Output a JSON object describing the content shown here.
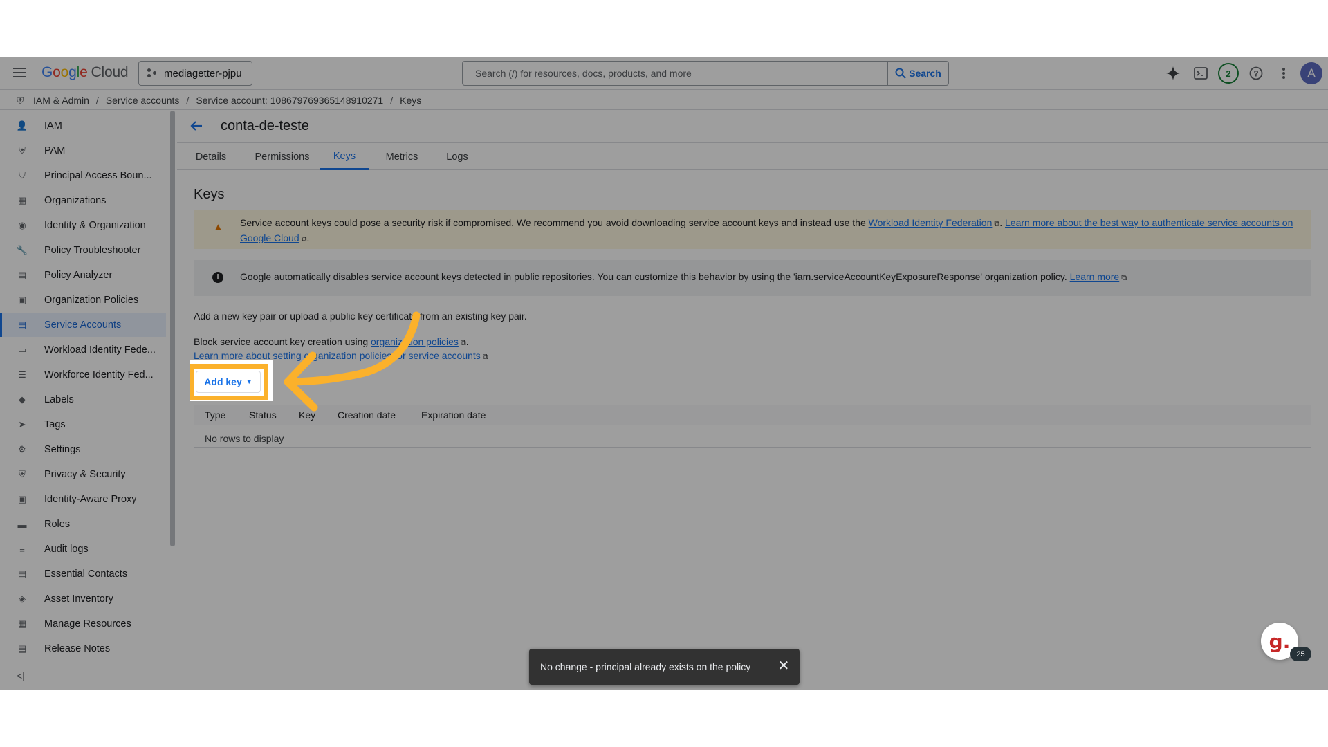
{
  "topbar": {
    "logo_google": [
      "G",
      "o",
      "o",
      "g",
      "l",
      "e"
    ],
    "logo_cloud": "Cloud",
    "project": "mediagetter-pjpu",
    "search_placeholder": "Search (/) for resources, docs, products, and more",
    "search_button": "Search",
    "notifications_count": "2",
    "avatar_initial": "A"
  },
  "breadcrumb": [
    "IAM & Admin",
    "Service accounts",
    "Service account: 108679769365148910271",
    "Keys"
  ],
  "sidebar": {
    "items": [
      {
        "label": "IAM",
        "icon": "person-add-icon",
        "glyph": "👤"
      },
      {
        "label": "PAM",
        "icon": "shield-icon",
        "glyph": "⛨"
      },
      {
        "label": "Principal Access Boun...",
        "icon": "policy-boundary-icon",
        "glyph": "⛉"
      },
      {
        "label": "Organizations",
        "icon": "building-icon",
        "glyph": "▦"
      },
      {
        "label": "Identity & Organization",
        "icon": "account-circle-icon",
        "glyph": "◉"
      },
      {
        "label": "Policy Troubleshooter",
        "icon": "wrench-icon",
        "glyph": "🔧"
      },
      {
        "label": "Policy Analyzer",
        "icon": "document-search-icon",
        "glyph": "▤"
      },
      {
        "label": "Organization Policies",
        "icon": "list-box-icon",
        "glyph": "▣"
      },
      {
        "label": "Service Accounts",
        "icon": "service-account-icon",
        "glyph": "▤",
        "active": true
      },
      {
        "label": "Workload Identity Fede...",
        "icon": "id-card-icon",
        "glyph": "▭"
      },
      {
        "label": "Workforce Identity Fed...",
        "icon": "list-icon",
        "glyph": "☰"
      },
      {
        "label": "Labels",
        "icon": "label-icon",
        "glyph": "◆"
      },
      {
        "label": "Tags",
        "icon": "tag-icon",
        "glyph": "➤"
      },
      {
        "label": "Settings",
        "icon": "gear-icon",
        "glyph": "⚙"
      },
      {
        "label": "Privacy & Security",
        "icon": "security-shield-icon",
        "glyph": "⛨"
      },
      {
        "label": "Identity-Aware Proxy",
        "icon": "proxy-icon",
        "glyph": "▣"
      },
      {
        "label": "Roles",
        "icon": "roles-hat-icon",
        "glyph": "▬"
      },
      {
        "label": "Audit logs",
        "icon": "audit-list-icon",
        "glyph": "≡"
      },
      {
        "label": "Essential Contacts",
        "icon": "contacts-icon",
        "glyph": "▤"
      },
      {
        "label": "Asset Inventory",
        "icon": "inventory-icon",
        "glyph": "◈"
      }
    ],
    "pinned": [
      {
        "label": "Manage Resources",
        "icon": "manage-resources-icon",
        "glyph": "▦"
      },
      {
        "label": "Release Notes",
        "icon": "release-notes-icon",
        "glyph": "▤"
      }
    ],
    "collapse": "<|"
  },
  "main": {
    "title": "conta-de-teste",
    "tabs": [
      "Details",
      "Permissions",
      "Keys",
      "Metrics",
      "Logs"
    ],
    "active_tab": "Keys",
    "section_title": "Keys",
    "warning": {
      "text": "Service account keys could pose a security risk if compromised. We recommend you avoid downloading service account keys and instead use the ",
      "link1": "Workload Identity Federation",
      "mid": ". ",
      "link2": "Learn more about the best way to authenticate service accounts on Google Cloud",
      "end": "."
    },
    "info": {
      "text": "Google automatically disables service account keys detected in public repositories. You can customize this behavior by using the 'iam.serviceAccountKeyExposureResponse' organization policy. ",
      "link": "Learn more"
    },
    "add_key_desc": "Add a new key pair or upload a public key certificate from an existing key pair.",
    "block_desc": "Block service account key creation using ",
    "block_link": "organization policies",
    "block_end": ".",
    "learn_link": "Learn more about setting organization policies for service accounts",
    "add_key_button": "Add key",
    "table": {
      "columns": [
        "Type",
        "Status",
        "Key",
        "Creation date",
        "Expiration date"
      ],
      "empty": "No rows to display"
    }
  },
  "toast": {
    "message": "No change - principal already exists on the policy"
  },
  "widget": {
    "letter": "g.",
    "badge": "25"
  },
  "colors": {
    "accent": "#1a73e8",
    "highlight": "#fbb12b",
    "warning_bg": "#fef7e0"
  }
}
